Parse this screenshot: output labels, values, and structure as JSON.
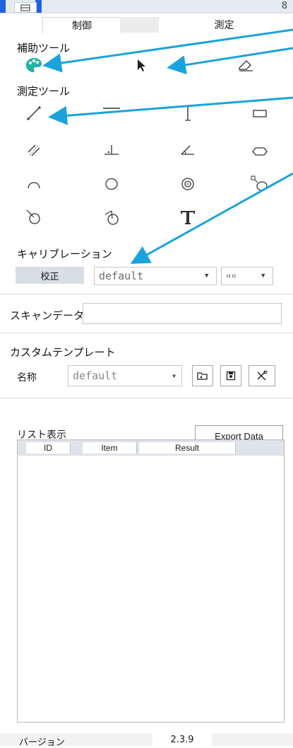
{
  "top": {
    "lock_symbol": "8"
  },
  "tabs": {
    "control": "制御",
    "measure": "測定"
  },
  "assist_tools": {
    "title": "補助ツール",
    "icons": [
      "palette-icon",
      "pointer-arrow-icon",
      "eraser-icon"
    ]
  },
  "measure_tools": {
    "title": "測定ツール",
    "icons": [
      "line-icon",
      "horizontal-line-icon",
      "vertical-line-icon",
      "rectangle-icon",
      "parallel-lines-icon",
      "perpendicular-icon",
      "angle-icon",
      "hexagon-icon",
      "arc-icon",
      "circle-icon",
      "concentric-circles-icon",
      "circle-corner-icon",
      "circle-center-line-icon",
      "circle-angle-icon",
      "text-icon"
    ]
  },
  "calibration": {
    "title": "キャリブレーション",
    "button": "校正",
    "profile": "default",
    "unit": "ㅁㅁ"
  },
  "scan_data": {
    "label": "スキャンデータ",
    "value": ""
  },
  "custom_template": {
    "title": "カスタムテンプレート",
    "name_label": "名称",
    "name_value": "default"
  },
  "list_view": {
    "title": "リスト表示",
    "export_button": "Export Data",
    "columns": [
      "ID",
      "Item",
      "Result"
    ],
    "rows": []
  },
  "version": {
    "label": "バージョン",
    "value": "2.3.9"
  },
  "colors": {
    "accent": "#1e63e0",
    "annotation": "#1aa3db",
    "palette": "#24b3a3"
  }
}
